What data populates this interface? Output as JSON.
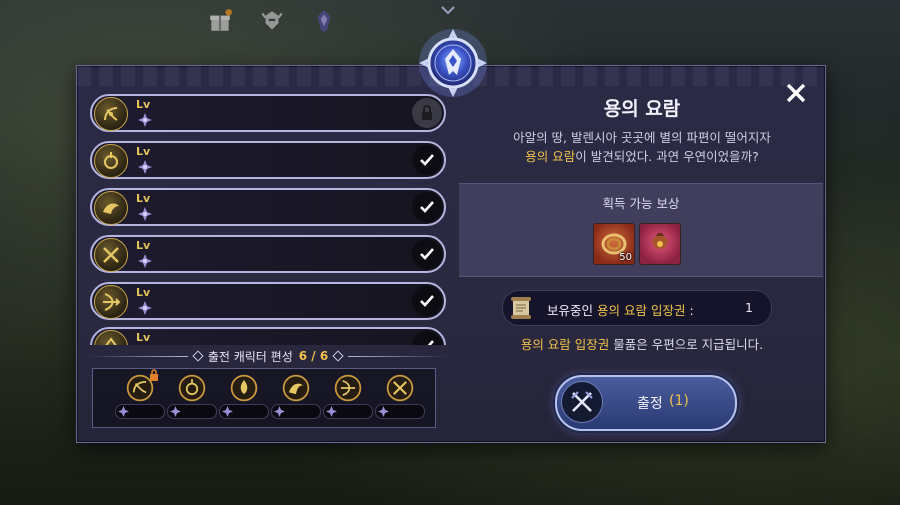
{
  "dialog": {
    "title": "용의 요람",
    "description_line1": "아알의 땅, 발렌시아 곳곳에 별의 파편이 떨어지자",
    "description_line2_highlight": "용의 요람",
    "description_line2_rest": "이 발견되었다. 과연 우연이었을까?",
    "close_icon": "close-icon"
  },
  "rewards": {
    "title": "획득 가능 보상",
    "items": [
      {
        "icon": "coiled-rope-icon",
        "count": "50",
        "color": "#b84a2a"
      },
      {
        "icon": "treasure-pouch-icon",
        "count": "",
        "color": "#c23a5c"
      }
    ]
  },
  "ticket": {
    "label_prefix": "보유중인",
    "label_highlight": "용의 요람 입장권",
    "label_suffix": ":",
    "count": "1",
    "icon": "scroll-icon"
  },
  "notice": {
    "highlight": "용의 요람 입장권",
    "rest": " 물품은 우편으로 지급됩니다."
  },
  "sortie_button": {
    "label": "출정",
    "count": "(1)",
    "icon": "crossed-swords-icon"
  },
  "characters": {
    "level_label": "Lv",
    "rows": [
      {
        "class_icon": "dancer-icon",
        "state": "locked"
      },
      {
        "class_icon": "mystic-icon",
        "state": "checked"
      },
      {
        "class_icon": "phoenix-icon",
        "state": "checked"
      },
      {
        "class_icon": "dual-blades-icon",
        "state": "checked"
      },
      {
        "class_icon": "archer-icon",
        "state": "checked"
      },
      {
        "class_icon": "ranger-icon",
        "state": "checked"
      }
    ]
  },
  "roster": {
    "title": "출전 캐릭터 편성",
    "count": "6 / 6",
    "slots": [
      {
        "class_icon": "dancer-icon",
        "locked": true
      },
      {
        "class_icon": "mystic-icon",
        "locked": false
      },
      {
        "class_icon": "flame-icon",
        "locked": false
      },
      {
        "class_icon": "dragon-icon",
        "locked": false
      },
      {
        "class_icon": "archer-icon",
        "locked": false
      },
      {
        "class_icon": "dual-blades-icon",
        "locked": false
      }
    ]
  },
  "colors": {
    "accent_gold": "#f0c24a",
    "panel": "#2b2a46",
    "row_border": "#b6b5de"
  }
}
